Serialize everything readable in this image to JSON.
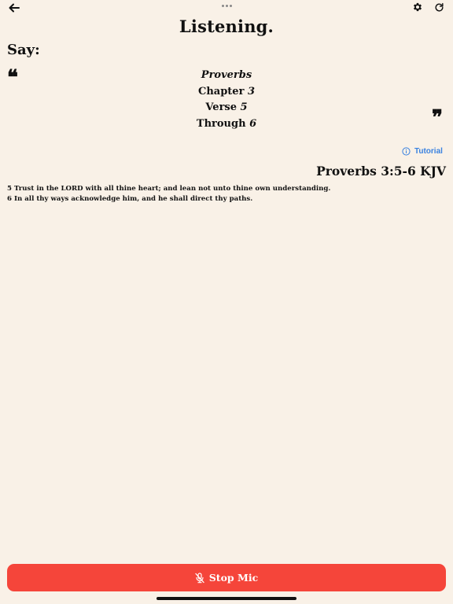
{
  "header": {
    "back_icon": "arrow-left-icon",
    "handle_icon": "drag-handle-icon",
    "settings_icon": "gear-icon",
    "refresh_icon": "refresh-icon"
  },
  "title": "Listening.",
  "say_label": "Say:",
  "prompt": {
    "book": "Proverbs",
    "chapter_label": "Chapter",
    "chapter_value": "3",
    "verse_label": "Verse",
    "verse_value": "5",
    "through_label": "Through",
    "through_value": "6"
  },
  "tutorial_label": "Tutorial",
  "reference": "Proverbs 3:5-6 KJV",
  "verses": [
    "5 Trust in the LORD with all thine heart; and lean not unto thine own understanding.",
    "6 In all thy ways acknowledge him, and he shall direct thy paths."
  ],
  "stop_button": {
    "label": "Stop Mic",
    "icon": "mic-off-icon"
  },
  "colors": {
    "background": "#f9f1e7",
    "accent_red": "#f5453a",
    "link_blue": "#3a82e0"
  }
}
